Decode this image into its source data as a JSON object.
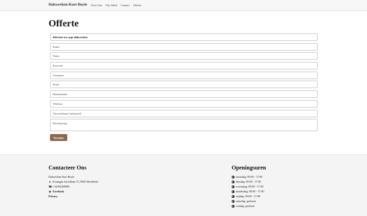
{
  "navbar": {
    "brand": "Dakwerken Kurt Boyle",
    "links": [
      "Over Ons",
      "Ons Werk",
      "Contact",
      "Offerte"
    ]
  },
  "page": {
    "title": "Offerte"
  },
  "form": {
    "select_value": "Selecteer uw type dakwerken",
    "placeholders": {
      "email": "Email",
      "name": "Naam",
      "postcode": "Postcode",
      "gemeente": "Gemeente",
      "straat": "Straat",
      "huisnummer": "Huisnummer",
      "telefoon": "Telefoon",
      "uitvoerdatum": "Uitvoerdatum (indicatief)",
      "beschrijving": "Beschrijving"
    },
    "submit_label": "Verstuur"
  },
  "footer": {
    "contact": {
      "title": "Contacteer Ons",
      "company": "Dakwerken Kurt Boyle",
      "address": "Koningin Astridlaan 73, 9820 Merelbeke",
      "phone": "+32492268906",
      "facebook": "Facebook",
      "privacy": "Privacy"
    },
    "hours": {
      "title": "Openingsuren",
      "lines": [
        "maandag: 09:00 - 17:00",
        "dinsdag: 09:00 - 17:00",
        "woensdag: 09:00 - 17:00",
        "donderdag: 09:00 - 17:00",
        "vrijdag: 09:00 - 17:00",
        "zaterdag: gesloten",
        "zondag: gesloten"
      ]
    }
  },
  "icons": {
    "address": "map-marker-icon",
    "phone": "phone-icon",
    "facebook": "facebook-icon",
    "hours": "clock-icon"
  },
  "colors": {
    "submit_bg": "#8a6a4a",
    "footer_bg": "#f4f4f4",
    "navbar_bg": "#f7f7f7"
  }
}
